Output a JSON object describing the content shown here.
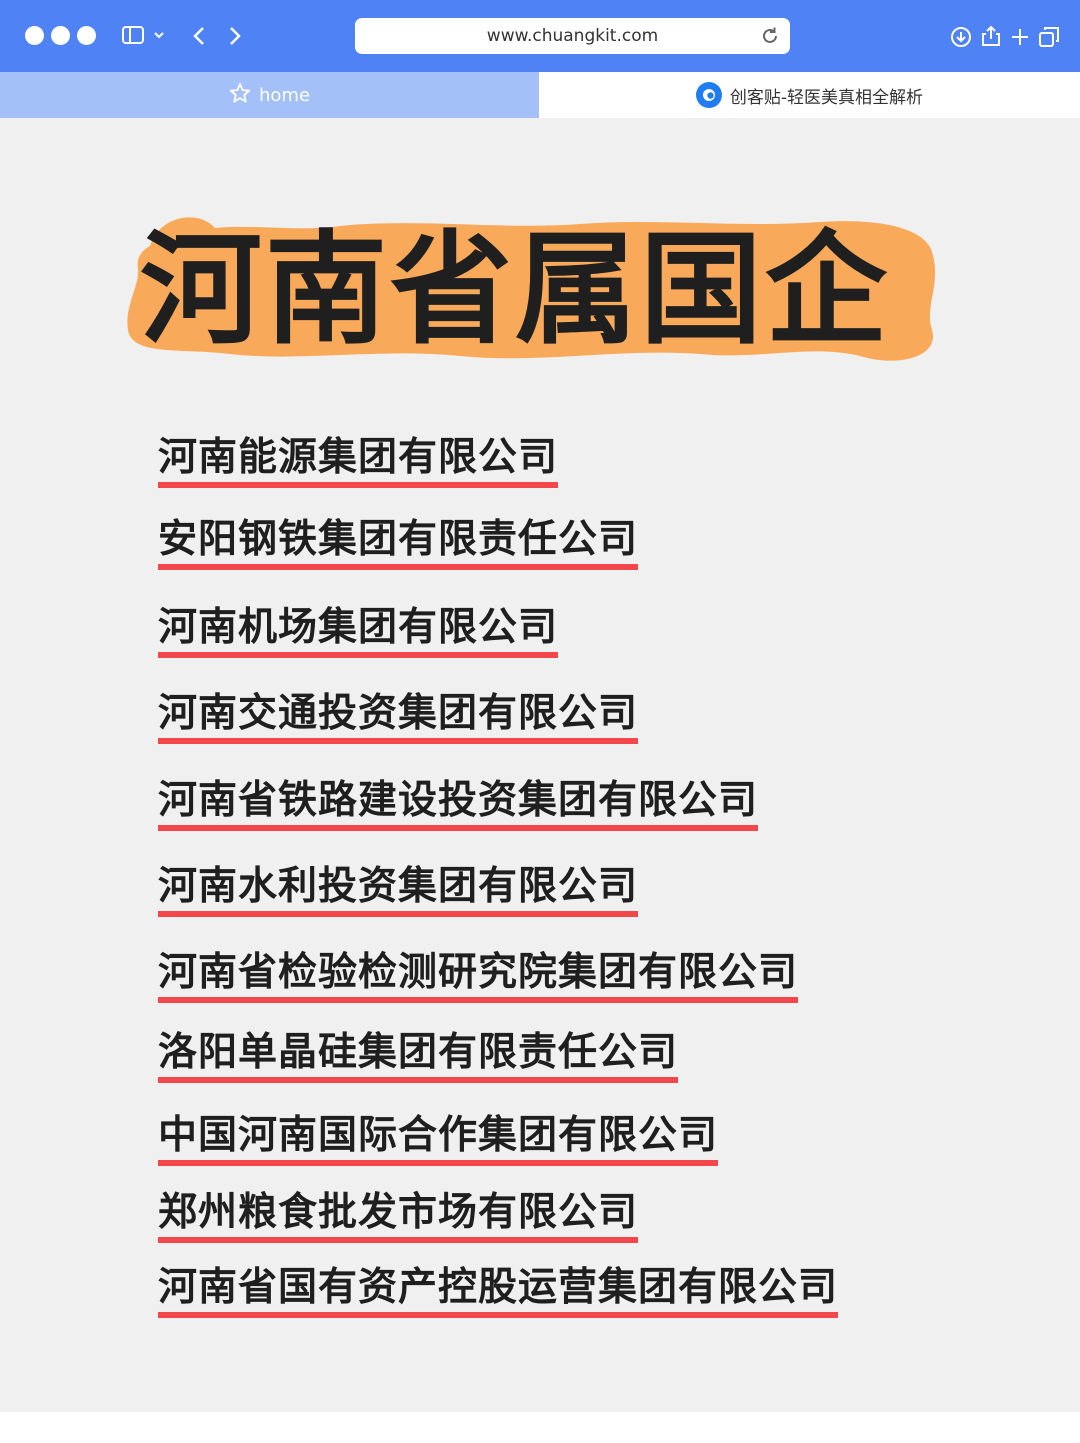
{
  "browser": {
    "url": "www.chuangkit.com",
    "tabs": [
      {
        "label": "home",
        "icon": "star-icon",
        "active": false
      },
      {
        "label": "创客贴-轻医美真相全解析",
        "icon": "chuangkit-logo-icon",
        "active": true
      }
    ],
    "colors": {
      "titlebar": "#4f82f4",
      "home_tab": "#a3c0f8",
      "favicon": "#1f7cf2"
    }
  },
  "content": {
    "title": "河南省属国企",
    "title_highlight_color": "#f9a95a",
    "underline_color": "#f2474b",
    "background": "#f0f0f0",
    "companies": [
      "河南能源集团有限公司",
      "安阳钢铁集团有限责任公司",
      "河南机场集团有限公司",
      "河南交通投资集团有限公司",
      "河南省铁路建设投资集团有限公司",
      "河南水利投资集团有限公司",
      "河南省检验检测研究院集团有限公司",
      "洛阳单晶硅集团有限责任公司",
      "中国河南国际合作集团有限公司",
      "郑州粮食批发市场有限公司",
      "河南省国有资产控股运营集团有限公司"
    ]
  }
}
